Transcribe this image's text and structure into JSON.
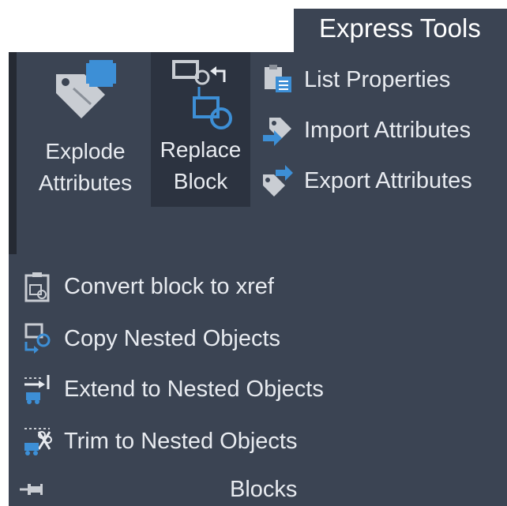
{
  "ribbon": {
    "tab_label": "Express Tools",
    "panel_title": "Blocks",
    "large_buttons": [
      {
        "line1": "Explode",
        "line2": "Attributes",
        "icon": "explode-attributes-icon"
      },
      {
        "line1": "Replace",
        "line2": "Block",
        "icon": "replace-block-icon"
      }
    ],
    "small_buttons": [
      {
        "label": "List Properties",
        "icon": "list-properties-icon"
      },
      {
        "label": "Import Attributes",
        "icon": "import-attributes-icon"
      },
      {
        "label": "Export Attributes",
        "icon": "export-attributes-icon"
      }
    ],
    "lower_buttons": [
      {
        "label": "Convert block to xref",
        "icon": "convert-block-xref-icon"
      },
      {
        "label": "Copy Nested Objects",
        "icon": "copy-nested-icon"
      },
      {
        "label": "Extend to Nested Objects",
        "icon": "extend-nested-icon"
      },
      {
        "label": "Trim to Nested Objects",
        "icon": "trim-nested-icon"
      }
    ],
    "pin_icon": "pin-panel-icon"
  },
  "colors": {
    "panel_bg": "#3b4453",
    "highlight_bg": "#2c3340",
    "accent_blue": "#3d8fd6",
    "text": "#e8ebf0"
  }
}
